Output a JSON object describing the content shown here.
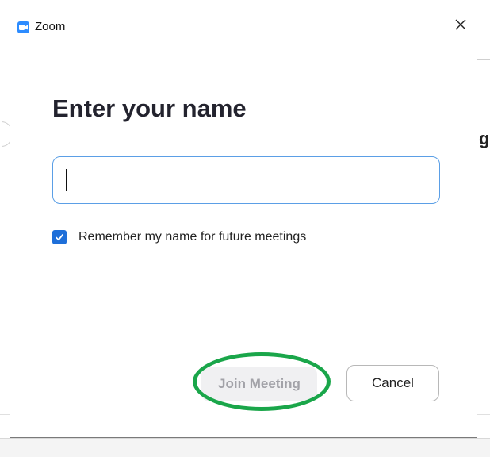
{
  "window": {
    "title": "Zoom",
    "app_icon": "zoom-camera-icon",
    "close_icon": "close-icon"
  },
  "dialog": {
    "heading": "Enter your name",
    "name_input": {
      "value": "",
      "placeholder": ""
    },
    "remember": {
      "label": "Remember my name for future meetings",
      "checked": true
    },
    "buttons": {
      "join": "Join Meeting",
      "join_enabled": false,
      "cancel": "Cancel"
    }
  },
  "background": {
    "partial_letter": "g"
  },
  "colors": {
    "accent": "#1e6fd9",
    "zoom_blue": "#2d8cff",
    "input_border": "#5b9fe6",
    "highlight_ring": "#1aa64a",
    "disabled_text": "#a2a2a8"
  }
}
